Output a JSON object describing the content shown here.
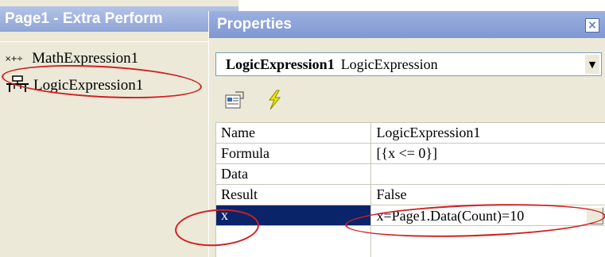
{
  "left_panel": {
    "title": "Page1 - Extra Perform",
    "items": [
      {
        "icon": "math-expression-icon",
        "glyph": "×+÷",
        "label": "MathExpression1"
      },
      {
        "icon": "logic-expression-icon",
        "glyph": "⊤",
        "label": "LogicExpression1"
      }
    ]
  },
  "properties": {
    "title": "Properties",
    "close_glyph": "×",
    "selector": {
      "object_name": "LogicExpression1",
      "object_type": "LogicExpression",
      "arrow": "▼"
    },
    "toolbar": {
      "properties_icon": "properties-page-icon",
      "events_icon": "lightning-events-icon"
    },
    "rows": [
      {
        "name": "Name",
        "value": "LogicExpression1"
      },
      {
        "name": "Formula",
        "value": "[{x <= 0}]"
      },
      {
        "name": "Data",
        "value": ""
      },
      {
        "name": "Result",
        "value": "False"
      },
      {
        "name": "x",
        "value": "x=Page1.Data(Count)=10",
        "selected": true
      }
    ]
  },
  "colors": {
    "selection": "#0a246a",
    "annotation": "#d21e1e",
    "title_bar": "#8fa5d6"
  }
}
